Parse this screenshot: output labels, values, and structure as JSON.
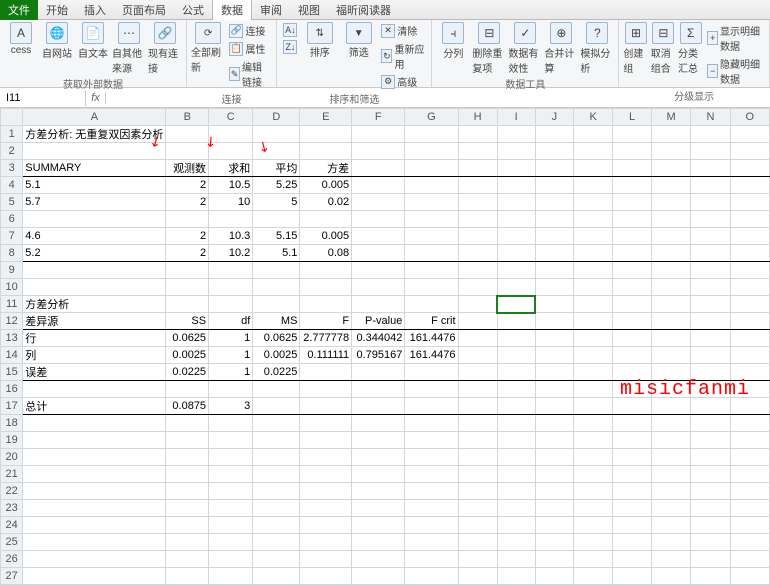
{
  "tabs": {
    "file": "文件",
    "t0": "开始",
    "t1": "插入",
    "t2": "页面布局",
    "t3": "公式",
    "t4": "数据",
    "t5": "审阅",
    "t6": "视图",
    "t7": "福昕阅读器"
  },
  "ribbon": {
    "g1": {
      "b0": "cess",
      "b1": "自网站",
      "b2": "自文本",
      "b3": "自其他来源",
      "b4": "现有连接",
      "label": "获取外部数据"
    },
    "g2": {
      "b0": "全部刷新",
      "m0": "连接",
      "m1": "属性",
      "m2": "编辑链接",
      "label": "连接"
    },
    "g3": {
      "b0": "排序",
      "b1": "筛选",
      "m0": "清除",
      "m1": "重新应用",
      "m2": "高级",
      "label": "排序和筛选"
    },
    "g4": {
      "b0": "分列",
      "b1": "删除重复项",
      "b2": "数据有效性",
      "b3": "合并计算",
      "b4": "模拟分析",
      "label": "数据工具"
    },
    "g5": {
      "b0": "创建组",
      "b1": "取消组合",
      "b2": "分类汇总",
      "m0": "显示明细数据",
      "m1": "隐藏明细数据",
      "label": "分级显示"
    }
  },
  "formula": {
    "cell": "I11",
    "fx": "fx",
    "value": ""
  },
  "cols": [
    "A",
    "B",
    "C",
    "D",
    "E",
    "F",
    "G",
    "H",
    "I",
    "J",
    "K",
    "L",
    "M",
    "N",
    "O"
  ],
  "sheet": {
    "r1": {
      "a": "方差分析: 无重复双因素分析"
    },
    "r3": {
      "a": "SUMMARY",
      "b": "观测数",
      "c": "求和",
      "d": "平均",
      "e": "方差"
    },
    "r4": {
      "a": "5.1",
      "b": "2",
      "c": "10.5",
      "d": "5.25",
      "e": "0.005"
    },
    "r5": {
      "a": "5.7",
      "b": "2",
      "c": "10",
      "d": "5",
      "e": "0.02"
    },
    "r7": {
      "a": "4.6",
      "b": "2",
      "c": "10.3",
      "d": "5.15",
      "e": "0.005"
    },
    "r8": {
      "a": "5.2",
      "b": "2",
      "c": "10.2",
      "d": "5.1",
      "e": "0.08"
    },
    "r11": {
      "a": "方差分析"
    },
    "r12": {
      "a": "差异源",
      "b": "SS",
      "c": "df",
      "d": "MS",
      "e": "F",
      "f": "P-value",
      "g": "F crit"
    },
    "r13": {
      "a": "行",
      "b": "0.0625",
      "c": "1",
      "d": "0.0625",
      "e": "2.777778",
      "f": "0.344042",
      "g": "161.4476"
    },
    "r14": {
      "a": "列",
      "b": "0.0025",
      "c": "1",
      "d": "0.0025",
      "e": "0.111111",
      "f": "0.795167",
      "g": "161.4476"
    },
    "r15": {
      "a": "误差",
      "b": "0.0225",
      "c": "1",
      "d": "0.0225"
    },
    "r17": {
      "a": "总计",
      "b": "0.0875",
      "c": "3"
    }
  },
  "watermark": "misicfanmi",
  "chart_data": {
    "type": "table",
    "title": "方差分析: 无重复双因素分析",
    "summary": {
      "headers": [
        "SUMMARY",
        "观测数",
        "求和",
        "平均",
        "方差"
      ],
      "rows": [
        [
          5.1,
          2,
          10.5,
          5.25,
          0.005
        ],
        [
          5.7,
          2,
          10,
          5,
          0.02
        ],
        [
          4.6,
          2,
          10.3,
          5.15,
          0.005
        ],
        [
          5.2,
          2,
          10.2,
          5.1,
          0.08
        ]
      ]
    },
    "anova": {
      "headers": [
        "差异源",
        "SS",
        "df",
        "MS",
        "F",
        "P-value",
        "F crit"
      ],
      "rows": [
        [
          "行",
          0.0625,
          1,
          0.0625,
          2.777778,
          0.344042,
          161.4476
        ],
        [
          "列",
          0.0025,
          1,
          0.0025,
          0.111111,
          0.795167,
          161.4476
        ],
        [
          "误差",
          0.0225,
          1,
          0.0225,
          null,
          null,
          null
        ],
        [
          "总计",
          0.0875,
          3,
          null,
          null,
          null,
          null
        ]
      ]
    }
  }
}
